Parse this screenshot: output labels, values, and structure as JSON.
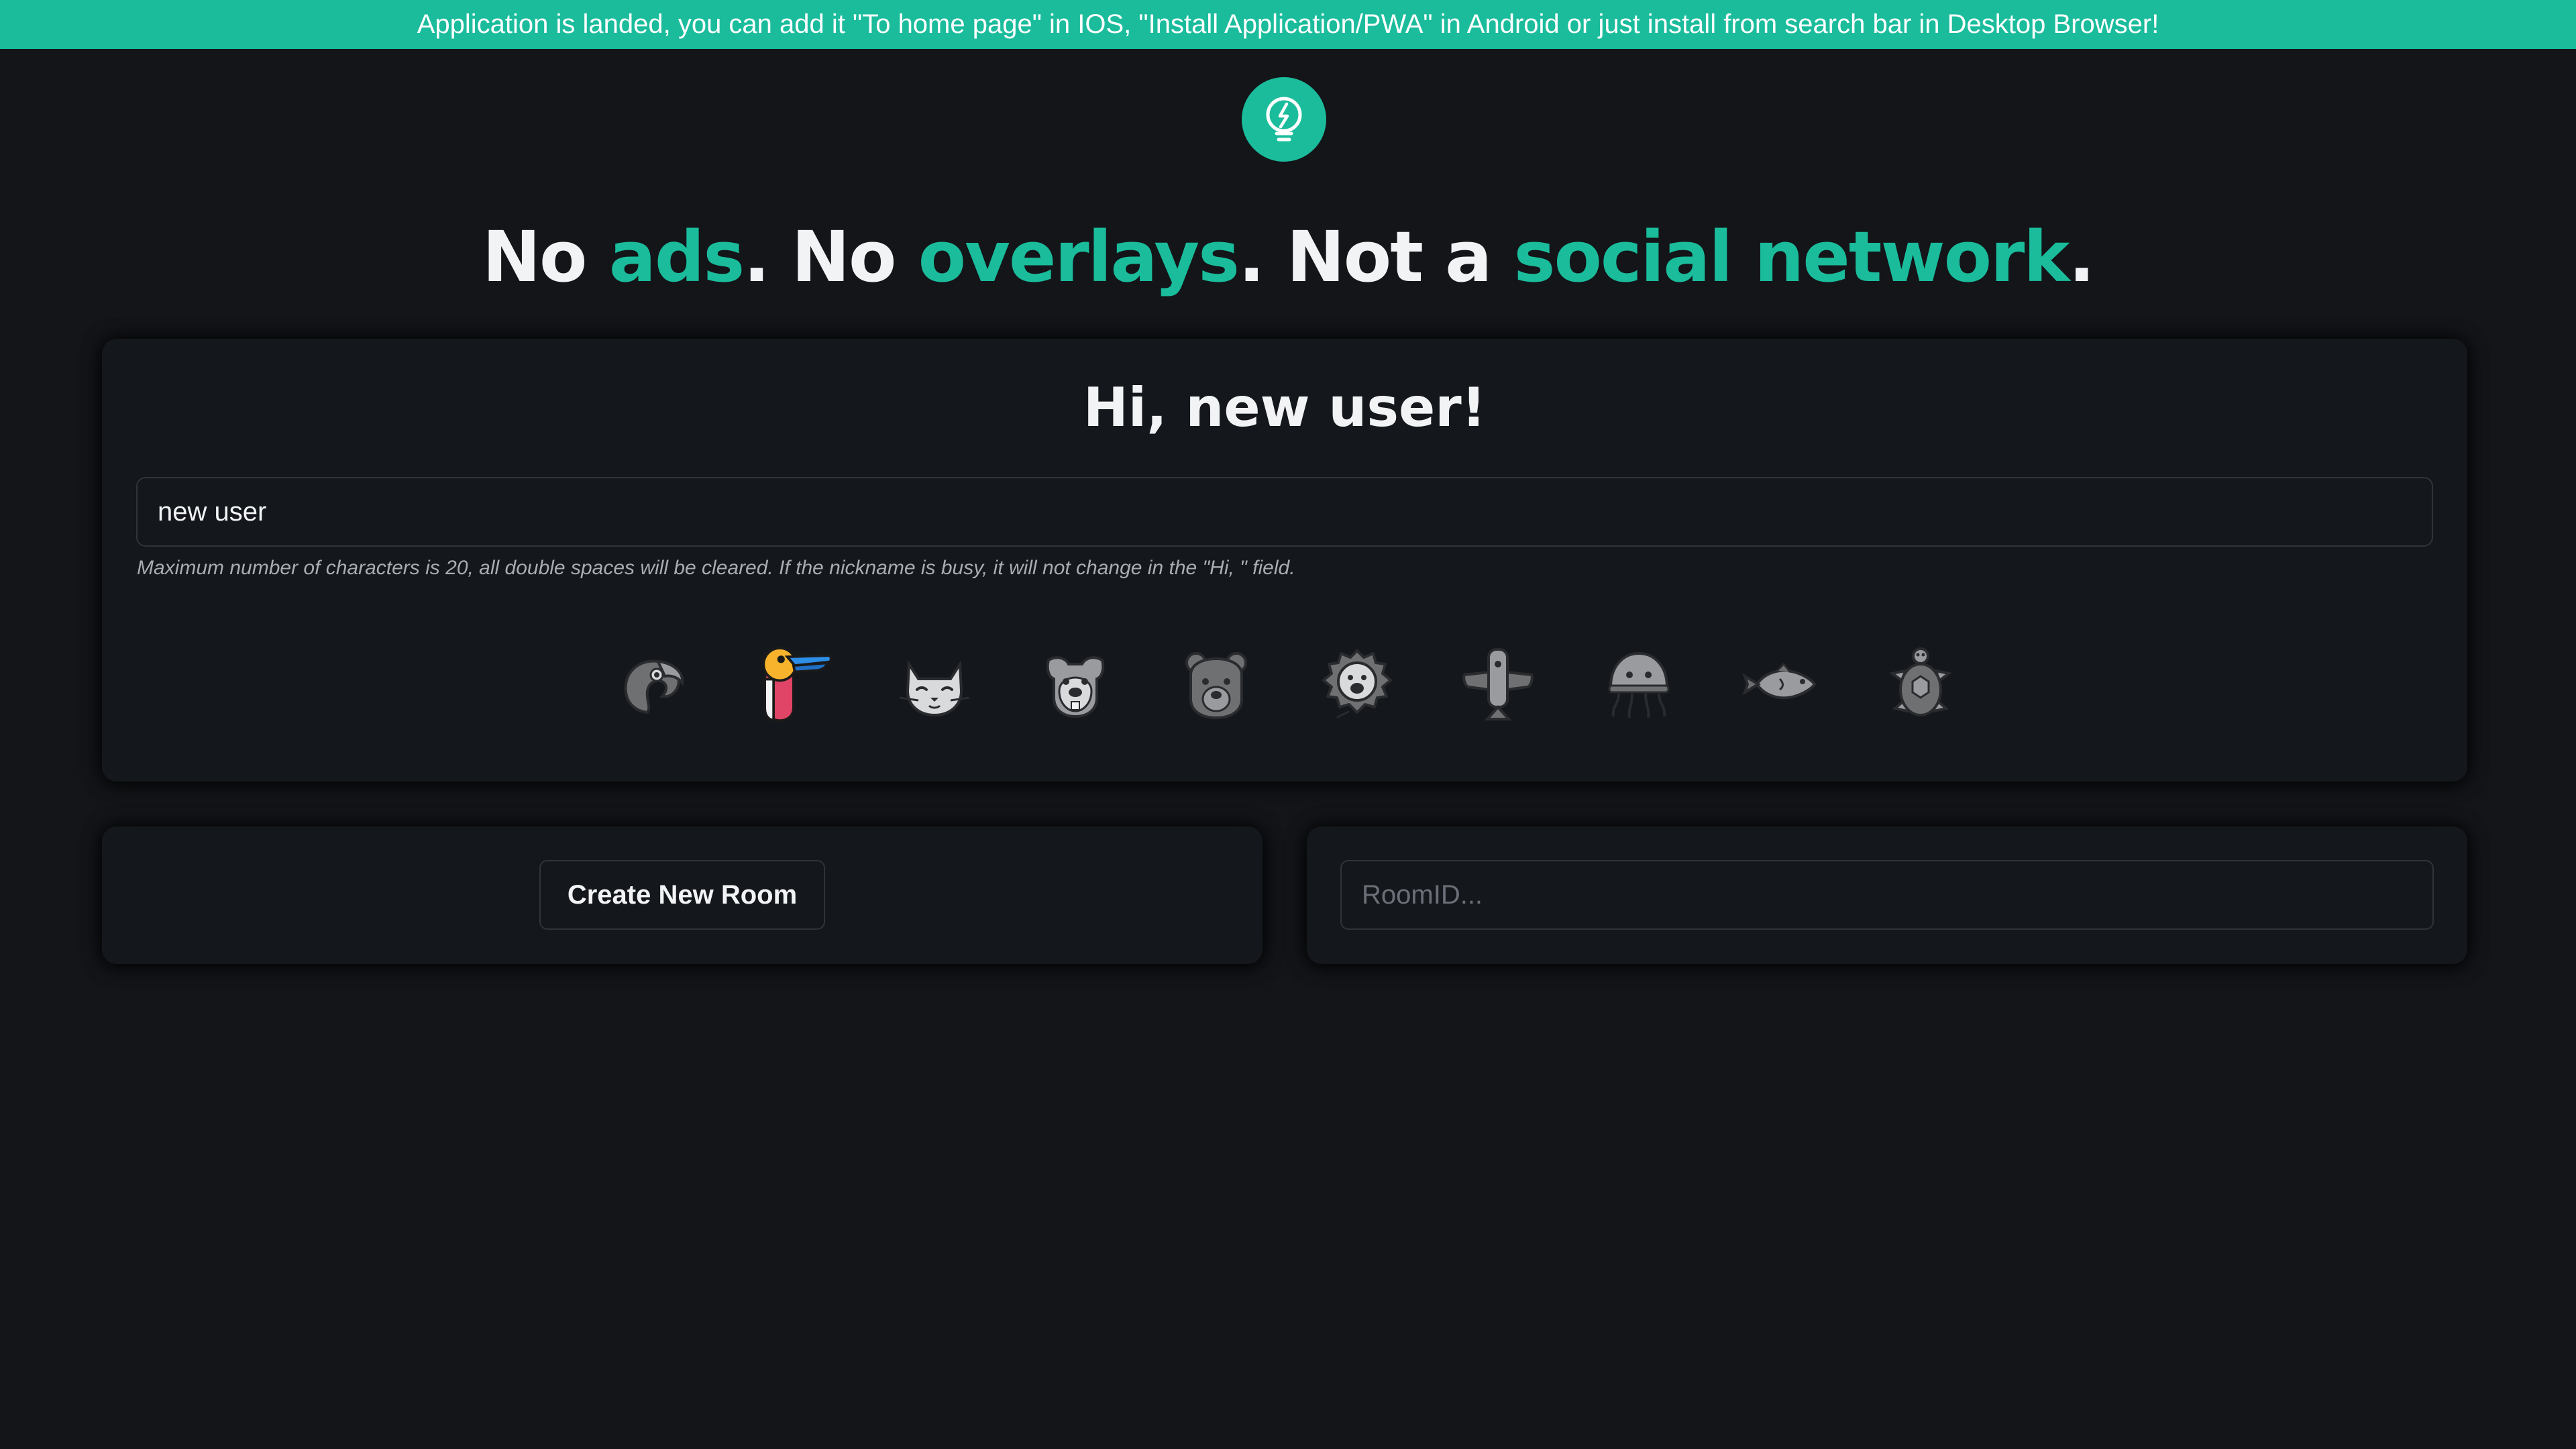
{
  "banner": {
    "text": "Application is landed, you can add it \"To home page\" in IOS, \"Install Application/PWA\" in Android or just install from search bar in Desktop Browser!"
  },
  "headline": {
    "parts": [
      "No ",
      "ads",
      ". No ",
      "overlays",
      ". Not a ",
      "social network",
      "."
    ]
  },
  "profile": {
    "greeting": "Hi, new user!",
    "nickname_value": "new user",
    "hint": "Maximum number of characters is 20, all double spaces will be cleared. If the nickname is busy, it will not change in the \"Hi, \" field."
  },
  "avatars": {
    "items": [
      "parrot-icon",
      "toucan-icon",
      "cat-icon",
      "dog-icon",
      "bear-icon",
      "lion-icon",
      "owl-icon",
      "jellyfish-icon",
      "fish-icon",
      "turtle-icon"
    ],
    "selected": "toucan-icon"
  },
  "actions": {
    "create_room_label": "Create New Room",
    "room_id_placeholder": "RoomID..."
  },
  "colors": {
    "accent": "#1abc9c",
    "background": "#131519",
    "text": "#f2f3f5"
  }
}
